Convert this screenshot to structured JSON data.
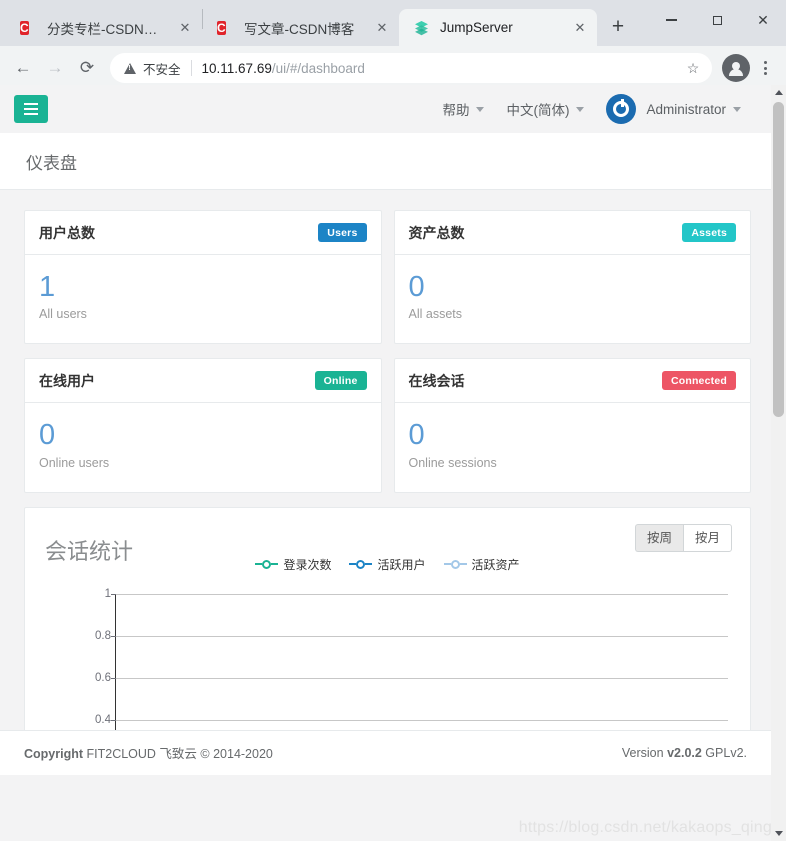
{
  "browser": {
    "tabs": [
      {
        "title": "分类专栏-CSDN博客",
        "favicon": "csdn-icon",
        "active": false
      },
      {
        "title": "写文章-CSDN博客",
        "favicon": "csdn-icon",
        "active": false
      },
      {
        "title": "JumpServer",
        "favicon": "jumpserver-icon",
        "active": true
      }
    ],
    "new_tab_label": "+",
    "close_label": "✕",
    "window_controls": {
      "minimize": "–",
      "maximize": "□",
      "close": "✕"
    },
    "nav": {
      "back": "←",
      "forward": "→",
      "reload": "⟳"
    },
    "omnibox": {
      "security_label": "不安全",
      "security_icon": "warning-triangle-icon",
      "url_host": "10.11.67.69",
      "url_path": "/ui/#/dashboard",
      "star_icon": "☆",
      "profile_icon": "profile-avatar-icon",
      "menu_icon": "kebab-menu-icon"
    }
  },
  "app": {
    "menu_toggle": "hamburger-icon",
    "nav": {
      "help": "帮助",
      "language": "中文(简体)",
      "user": "Administrator",
      "logo": "jumpserver-logo-icon"
    },
    "page_title": "仪表盘"
  },
  "stats": [
    {
      "title": "用户总数",
      "badge": "Users",
      "badge_color": "#1c84c6",
      "value": "1",
      "caption": "All users"
    },
    {
      "title": "资产总数",
      "badge": "Assets",
      "badge_color": "#23c6c8",
      "value": "0",
      "caption": "All assets"
    },
    {
      "title": "在线用户",
      "badge": "Online",
      "badge_color": "#1ab394",
      "value": "0",
      "caption": "Online users"
    },
    {
      "title": "在线会话",
      "badge": "Connected",
      "badge_color": "#ed5565",
      "value": "0",
      "caption": "Online sessions"
    }
  ],
  "chart_card": {
    "title": "会话统计",
    "range_buttons": [
      {
        "label": "按周",
        "active": true
      },
      {
        "label": "按月",
        "active": false
      }
    ]
  },
  "chart_data": {
    "type": "line",
    "title": "会话统计",
    "xlabel": "",
    "ylabel": "",
    "ylim": [
      0,
      1
    ],
    "yticks": [
      "1",
      "0.8",
      "0.6",
      "0.4"
    ],
    "grid": true,
    "legend_position": "top-center",
    "categories": [],
    "series": [
      {
        "name": "登录次数",
        "color": "#1ab394",
        "values": []
      },
      {
        "name": "活跃用户",
        "color": "#1c84c6",
        "values": []
      },
      {
        "name": "活跃资产",
        "color": "#a3c8e8",
        "values": []
      }
    ]
  },
  "footer": {
    "copyright_bold": "Copyright",
    "copyright_text": " FIT2CLOUD 飞致云 © 2014-2020",
    "version_label": "Version ",
    "version_number": "v2.0.2",
    "license": " GPLv2."
  },
  "watermark": "https://blog.csdn.net/kakaops_qing"
}
